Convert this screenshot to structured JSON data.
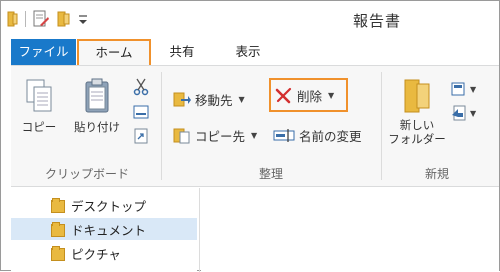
{
  "window": {
    "title": "報告書"
  },
  "tabs": [
    {
      "label": "ファイル"
    },
    {
      "label": "ホーム"
    },
    {
      "label": "共有"
    },
    {
      "label": "表示"
    }
  ],
  "ribbon": {
    "clipboard": {
      "group_label": "クリップボード",
      "copy_label": "コピー",
      "paste_label": "貼り付け"
    },
    "organize": {
      "group_label": "整理",
      "move_to_label": "移動先",
      "copy_to_label": "コピー先",
      "delete_label": "削除",
      "rename_label": "名前の変更"
    },
    "new": {
      "group_label": "新規",
      "new_folder_line1": "新しい",
      "new_folder_line2": "フォルダー"
    }
  },
  "nav": {
    "items": [
      {
        "label": "デスクトップ"
      },
      {
        "label": "ドキュメント",
        "selected": true
      },
      {
        "label": "ピクチャ"
      }
    ]
  },
  "colors": {
    "accent": "#1979ca",
    "highlight": "#f0912c",
    "selection": "#d9e8f7"
  }
}
